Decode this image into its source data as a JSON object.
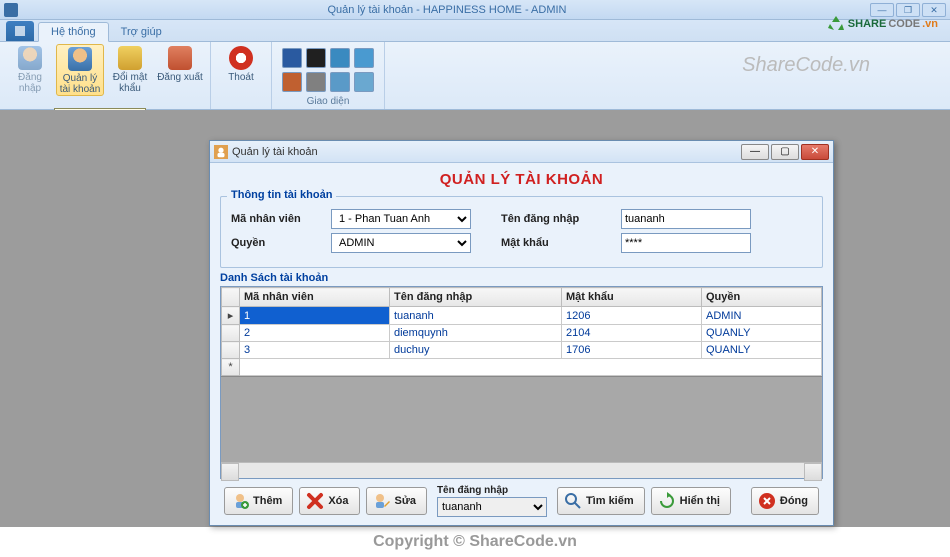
{
  "main_window": {
    "title": "Quản lý tài khoản - HAPPINESS HOME - ADMIN"
  },
  "ribbon": {
    "tabs": [
      "Hệ thống",
      "Trợ giúp"
    ],
    "active_tab": "Hệ thống",
    "buttons": {
      "login": "Đăng nhập",
      "accounts": "Quản lý tài khoản",
      "change_pw": "Đổi mật khẩu",
      "logout": "Đăng xuất",
      "exit": "Thoát"
    },
    "group_theme_label": "Giao diện",
    "tooltip": "Quản lý tài khoản"
  },
  "child": {
    "title": "Quản lý tài khoản",
    "heading": "QUẢN LÝ TÀI KHOẢN",
    "group_info_label": "Thông tin tài khoản",
    "labels": {
      "employee_id": "Mã nhân viên",
      "role": "Quyền",
      "username": "Tên đăng nhập",
      "password": "Mật khẩu"
    },
    "fields": {
      "employee_selected": "1 - Phan Tuan Anh",
      "role_selected": "ADMIN",
      "username_value": "tuananh",
      "password_value": "****"
    },
    "list_label": "Danh Sách tài khoản",
    "columns": [
      "Mã nhân viên",
      "Tên đăng nhập",
      "Mật khẩu",
      "Quyền"
    ],
    "rows": [
      {
        "id": "1",
        "user": "tuananh",
        "pw": "1206",
        "role": "ADMIN"
      },
      {
        "id": "2",
        "user": "diemquynh",
        "pw": "2104",
        "role": "QUANLY"
      },
      {
        "id": "3",
        "user": "duchuy",
        "pw": "1706",
        "role": "QUANLY"
      }
    ],
    "toolbar": {
      "add": "Thêm",
      "delete": "Xóa",
      "edit": "Sửa",
      "search_label": "Tên đăng nhập",
      "search_value": "tuananh",
      "search": "Tìm kiếm",
      "show": "Hiển thị",
      "close": "Đóng"
    }
  },
  "watermark": {
    "logo_share": "SHARE",
    "logo_code": "CODE",
    "logo_tld": ".vn",
    "text": "ShareCode.vn",
    "copyright": "Copyright © ShareCode.vn"
  }
}
